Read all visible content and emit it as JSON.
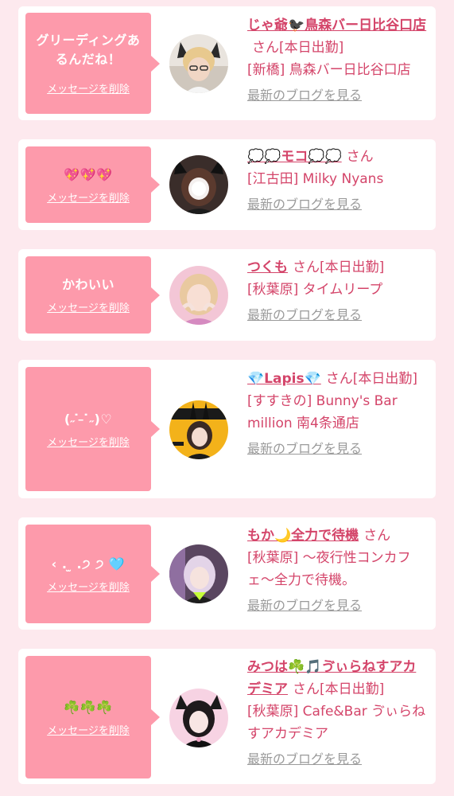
{
  "delete_label": "メッセージを削除",
  "blog_label": "最新のブログを見る",
  "honorific": "さん",
  "colors": {
    "background": "#fde9ee",
    "message_box": "#fd9aab",
    "accent_text": "#d4456a",
    "muted_text": "#9a9a9a"
  },
  "cards": [
    {
      "message": "グリーディングあるんだね！",
      "name": "じゃ爺🐦‍⬛鳥森バー日比谷口店",
      "status": "[本日出勤]",
      "shop": "[新橋] 鳥森バー日比谷口店"
    },
    {
      "message": "💖💖💖",
      "name": "💭💭モコ💭💭",
      "status": "",
      "shop": "[江古田] Milky Nyans"
    },
    {
      "message": "かわいい",
      "name": "つくも",
      "status": "[本日出勤]",
      "shop": "[秋葉原] タイムリープ"
    },
    {
      "message": "(˶ ̇ ̵ ̇˶)♡",
      "name": "💎Lapis💎",
      "status": "[本日出勤]",
      "shop": "[すすきの] Bunny's Bar million 南4条通店"
    },
    {
      "message": "‹ . ̫ .੭ ੭ 🩵",
      "name": "もか🌙全力で待機",
      "status": "",
      "shop": "[秋葉原] 〜夜行性コンカフェ〜全力で待機。"
    },
    {
      "message": "☘️☘️☘️",
      "name": "みつは☘️🎵ゔぃらねすアカデミア",
      "status": "[本日出勤]",
      "shop": "[秋葉原] Cafe&Bar ゔぃらねすアカデミア"
    }
  ]
}
